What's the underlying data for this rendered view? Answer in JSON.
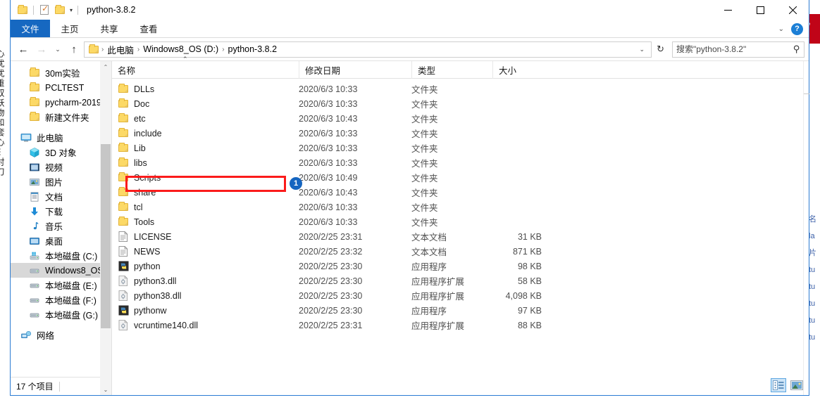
{
  "background": {
    "left_text": "心扰扰重双袄物和套心⋯对刀",
    "right_text": "名 la 片 tu tu tu tu tu",
    "banner_mark": "7"
  },
  "titlebar": {
    "title": "python-3.8.2",
    "quick_access": [
      {
        "name": "folder-icon",
        "label": ""
      },
      {
        "name": "properties-icon",
        "label": ""
      },
      {
        "name": "new-folder-icon",
        "label": ""
      },
      {
        "name": "customize-caret-icon",
        "label": "▾"
      }
    ],
    "minimize": "—",
    "maximize": "□",
    "close": "✕"
  },
  "ribbon": {
    "tabs": [
      {
        "id": "file",
        "label": "文件"
      },
      {
        "id": "home",
        "label": "主页"
      },
      {
        "id": "share",
        "label": "共享"
      },
      {
        "id": "view",
        "label": "查看"
      }
    ],
    "collapse_caret": "⌄",
    "help_label": "?"
  },
  "address": {
    "back": "←",
    "forward": "→",
    "recent": "⌄",
    "up": "↑",
    "breadcrumbs": [
      "此电脑",
      "Windows8_OS (D:)",
      "python-3.8.2"
    ],
    "separator": "›",
    "dropdown_caret": "⌄",
    "refresh": "↻"
  },
  "search": {
    "placeholder": "搜索\"python-3.8.2\"",
    "value": "",
    "icon": "search-icon"
  },
  "sidebar": {
    "groups": [
      {
        "items": [
          {
            "label": "30m实验",
            "icon": "folder-icon",
            "indent": true,
            "selected": false
          },
          {
            "label": "PCLTEST",
            "icon": "folder-icon",
            "indent": true,
            "selected": false
          },
          {
            "label": "pycharm-2019.",
            "icon": "folder-icon",
            "indent": true,
            "selected": false
          },
          {
            "label": "新建文件夹",
            "icon": "folder-icon",
            "indent": true,
            "selected": false
          }
        ]
      },
      {
        "items": [
          {
            "label": "此电脑",
            "icon": "this-pc-icon",
            "indent": false,
            "selected": false
          },
          {
            "label": "3D 对象",
            "icon": "3d-objects-icon",
            "indent": true,
            "selected": false
          },
          {
            "label": "视频",
            "icon": "videos-icon",
            "indent": true,
            "selected": false
          },
          {
            "label": "图片",
            "icon": "pictures-icon",
            "indent": true,
            "selected": false
          },
          {
            "label": "文档",
            "icon": "documents-icon",
            "indent": true,
            "selected": false
          },
          {
            "label": "下载",
            "icon": "downloads-icon",
            "indent": true,
            "selected": false
          },
          {
            "label": "音乐",
            "icon": "music-icon",
            "indent": true,
            "selected": false
          },
          {
            "label": "桌面",
            "icon": "desktop-icon",
            "indent": true,
            "selected": false
          },
          {
            "label": "本地磁盘 (C:)",
            "icon": "windows-drive-icon",
            "indent": true,
            "selected": false
          },
          {
            "label": "Windows8_OS",
            "icon": "drive-icon",
            "indent": true,
            "selected": true
          },
          {
            "label": "本地磁盘 (E:)",
            "icon": "drive-icon",
            "indent": true,
            "selected": false
          },
          {
            "label": "本地磁盘 (F:)",
            "icon": "drive-icon",
            "indent": true,
            "selected": false
          },
          {
            "label": "本地磁盘 (G:)",
            "icon": "drive-icon",
            "indent": true,
            "selected": false
          }
        ]
      },
      {
        "items": [
          {
            "label": "网络",
            "icon": "network-icon",
            "indent": false,
            "selected": false
          }
        ]
      }
    ],
    "scroll_up": "⌃",
    "scroll_down": "⌄"
  },
  "columns": [
    {
      "id": "name",
      "label": "名称",
      "sorted": true,
      "sort_caret": "⌃"
    },
    {
      "id": "date",
      "label": "修改日期",
      "sorted": false
    },
    {
      "id": "type",
      "label": "类型",
      "sorted": false
    },
    {
      "id": "size",
      "label": "大小",
      "sorted": false
    }
  ],
  "files": [
    {
      "name": "DLLs",
      "date": "2020/6/3 10:33",
      "type": "文件夹",
      "size": "",
      "icon": "folder-icon"
    },
    {
      "name": "Doc",
      "date": "2020/6/3 10:33",
      "type": "文件夹",
      "size": "",
      "icon": "folder-icon"
    },
    {
      "name": "etc",
      "date": "2020/6/3 10:43",
      "type": "文件夹",
      "size": "",
      "icon": "folder-icon"
    },
    {
      "name": "include",
      "date": "2020/6/3 10:33",
      "type": "文件夹",
      "size": "",
      "icon": "folder-icon"
    },
    {
      "name": "Lib",
      "date": "2020/6/3 10:33",
      "type": "文件夹",
      "size": "",
      "icon": "folder-icon"
    },
    {
      "name": "libs",
      "date": "2020/6/3 10:33",
      "type": "文件夹",
      "size": "",
      "icon": "folder-icon"
    },
    {
      "name": "Scripts",
      "date": "2020/6/3 10:49",
      "type": "文件夹",
      "size": "",
      "icon": "folder-icon"
    },
    {
      "name": "share",
      "date": "2020/6/3 10:43",
      "type": "文件夹",
      "size": "",
      "icon": "folder-icon"
    },
    {
      "name": "tcl",
      "date": "2020/6/3 10:33",
      "type": "文件夹",
      "size": "",
      "icon": "folder-icon"
    },
    {
      "name": "Tools",
      "date": "2020/6/3 10:33",
      "type": "文件夹",
      "size": "",
      "icon": "folder-icon"
    },
    {
      "name": "LICENSE",
      "date": "2020/2/25 23:31",
      "type": "文本文档",
      "size": "31 KB",
      "icon": "text-file-icon"
    },
    {
      "name": "NEWS",
      "date": "2020/2/25 23:32",
      "type": "文本文档",
      "size": "871 KB",
      "icon": "text-file-icon"
    },
    {
      "name": "python",
      "date": "2020/2/25 23:30",
      "type": "应用程序",
      "size": "98 KB",
      "icon": "python-exe-icon"
    },
    {
      "name": "python3.dll",
      "date": "2020/2/25 23:30",
      "type": "应用程序扩展",
      "size": "58 KB",
      "icon": "dll-icon"
    },
    {
      "name": "python38.dll",
      "date": "2020/2/25 23:30",
      "type": "应用程序扩展",
      "size": "4,098 KB",
      "icon": "dll-icon"
    },
    {
      "name": "pythonw",
      "date": "2020/2/25 23:30",
      "type": "应用程序",
      "size": "97 KB",
      "icon": "python-exe-icon"
    },
    {
      "name": "vcruntime140.dll",
      "date": "2020/2/25 23:31",
      "type": "应用程序扩展",
      "size": "88 KB",
      "icon": "dll-icon"
    }
  ],
  "statusbar": {
    "item_count": "17 个项目"
  },
  "view_buttons": {
    "details": "details-view-icon",
    "large_icons": "large-icons-view-icon"
  },
  "annotation": {
    "badge_label": "1",
    "target": "Scripts",
    "box_color": "#fb1b1b",
    "badge_color": "#1565c0"
  }
}
